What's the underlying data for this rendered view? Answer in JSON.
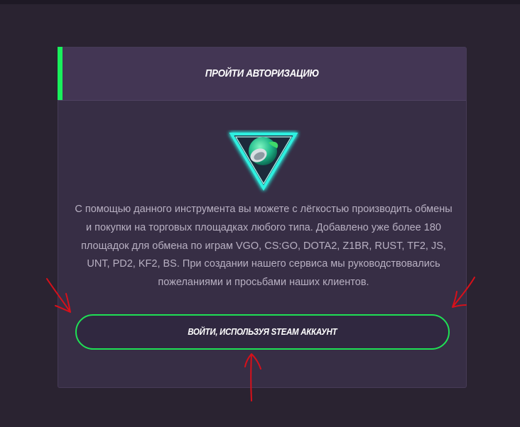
{
  "auth_panel": {
    "title": "ПРОЙТИ АВТОРИЗАЦИЮ",
    "logo_icon": "neon-triangle-leaf-logo",
    "description": "С помощью данного инструмента вы можете с лёгкостью производить обмены и покупки на торговых площадках любого типа. Добавлено уже более 180 площадок для обмена по играм VGO, CS:GO, DOTA2, Z1BR, RUST, TF2, JS, UNT, PD2, KF2, BS. При создании нашего сервиса мы руководствовались пожеланиями и просьбами наших клиентов.",
    "steam_button_label": "ВОЙТИ, ИСПОЛЬЗУЯ STEAM АККАУНТ"
  },
  "colors": {
    "background": "#2a2331",
    "panel": "#372e45",
    "header": "#433654",
    "accent_green": "#19f05c",
    "logo_cyan": "#2ff0e0",
    "annotation_red": "#d8101a"
  }
}
